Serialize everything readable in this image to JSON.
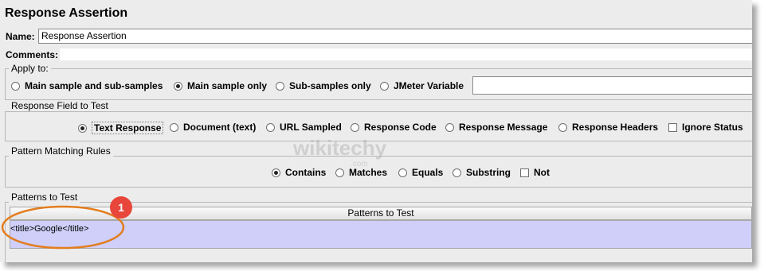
{
  "title": "Response Assertion",
  "name_field": {
    "label": "Name:",
    "value": "Response Assertion"
  },
  "comments_field": {
    "label": "Comments:",
    "value": ""
  },
  "apply_to": {
    "legend": "Apply to:",
    "options": [
      {
        "label": "Main sample and sub-samples",
        "selected": false
      },
      {
        "label": "Main sample only",
        "selected": true
      },
      {
        "label": "Sub-samples only",
        "selected": false
      },
      {
        "label": "JMeter Variable",
        "selected": false
      }
    ],
    "variable_value": ""
  },
  "response_field": {
    "legend": "Response Field to Test",
    "options": [
      {
        "label": "Text Response",
        "selected": true
      },
      {
        "label": "Document (text)",
        "selected": false
      },
      {
        "label": "URL Sampled",
        "selected": false
      },
      {
        "label": "Response Code",
        "selected": false
      },
      {
        "label": "Response Message",
        "selected": false
      },
      {
        "label": "Response Headers",
        "selected": false
      }
    ],
    "ignore_status": {
      "label": "Ignore Status",
      "checked": false
    }
  },
  "pattern_rules": {
    "legend": "Pattern Matching Rules",
    "options": [
      {
        "label": "Contains",
        "selected": true
      },
      {
        "label": "Matches",
        "selected": false
      },
      {
        "label": "Equals",
        "selected": false
      },
      {
        "label": "Substring",
        "selected": false
      }
    ],
    "not": {
      "label": "Not",
      "checked": false
    }
  },
  "patterns": {
    "legend": "Patterns to Test",
    "column_header": "Patterns to Test",
    "rows": [
      "<title>Google</title>"
    ]
  },
  "callout": {
    "number": "1",
    "color": "#e8463a",
    "ellipse_color": "#e37d1e"
  },
  "watermark": {
    "main": "wikitechy",
    "sub": ".com"
  },
  "colors": {
    "selected_row": "#cfcff9",
    "background": "#ececec"
  }
}
